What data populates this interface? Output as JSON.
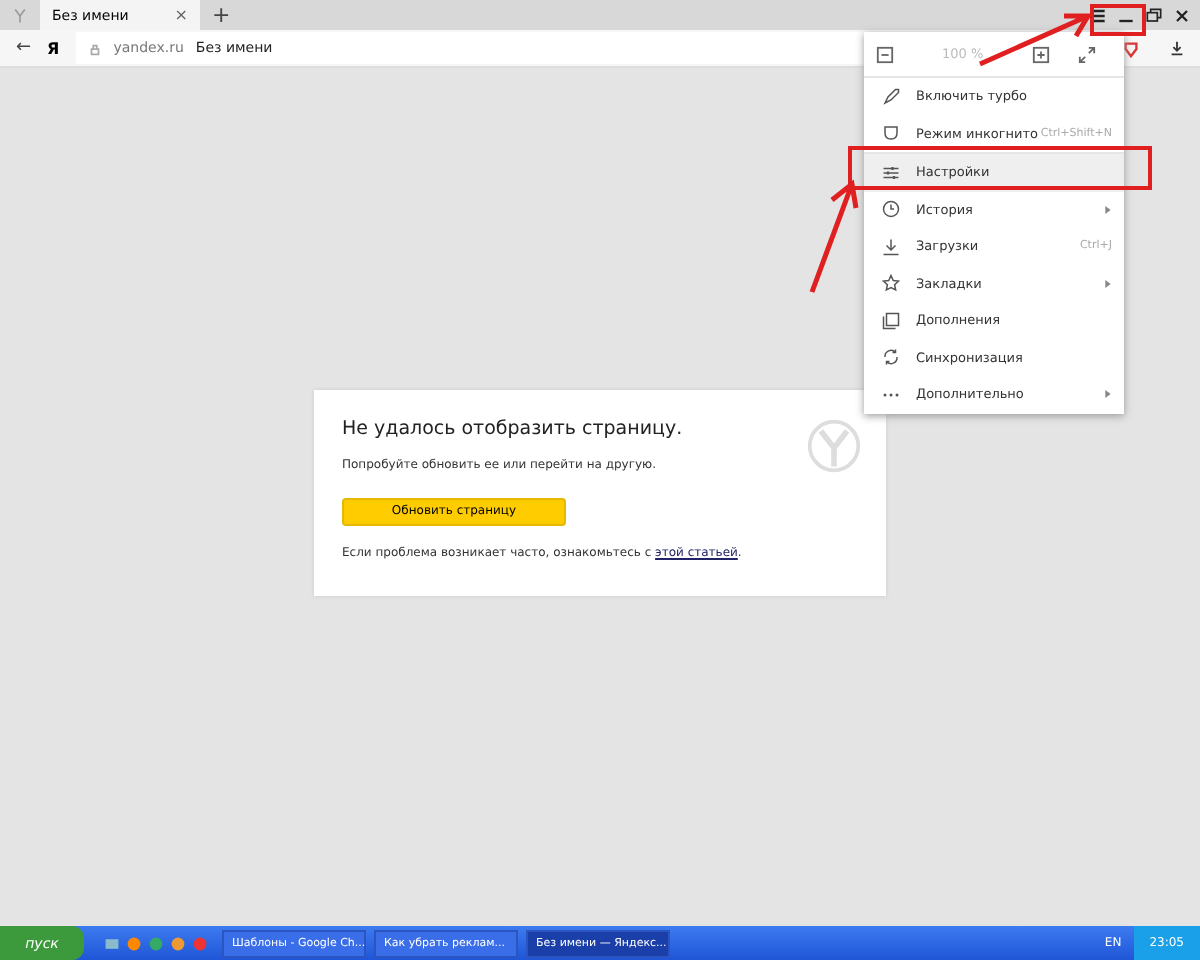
{
  "tab": {
    "title": "Без имени",
    "close": "×",
    "new_tab": "+"
  },
  "address_bar": {
    "back": "←",
    "logo": "Я",
    "domain": "yandex.ru",
    "page_title": "Без имени"
  },
  "menu": {
    "zoom": "100 %",
    "items": [
      {
        "label": "Включить турбо",
        "kind": "turbo",
        "submenu": false,
        "highlighted": false
      },
      {
        "label": "Режим инкогнито",
        "kind": "incognito",
        "shortcut": "Ctrl+Shift+N",
        "submenu": false,
        "highlighted": false
      },
      {
        "label": "Настройки",
        "kind": "settings",
        "submenu": false,
        "highlighted": true
      },
      {
        "label": "История",
        "kind": "history",
        "submenu": true,
        "highlighted": false
      },
      {
        "label": "Загрузки",
        "kind": "download",
        "shortcut": "Ctrl+J",
        "submenu": false,
        "highlighted": false
      },
      {
        "label": "Закладки",
        "kind": "star",
        "submenu": true,
        "highlighted": false
      },
      {
        "label": "Дополнения",
        "kind": "addons",
        "submenu": false,
        "highlighted": false
      },
      {
        "label": "Синхронизация",
        "kind": "sync",
        "submenu": false,
        "highlighted": false
      },
      {
        "label": "Дополнительно",
        "kind": "more",
        "submenu": true,
        "highlighted": false
      }
    ]
  },
  "error_card": {
    "title": "Не удалось отобразить страницу.",
    "hint": "Попробуйте обновить ее или перейти на другую.",
    "button": "Обновить страницу",
    "note": "Если проблема возникает часто, ознакомьтесь с ",
    "link": "этой статьей",
    "note_end": "."
  },
  "taskbar": {
    "start": "пуск",
    "windows": [
      {
        "label": "Шаблоны - Google Ch...",
        "selected": false
      },
      {
        "label": "Как убрать реклам...",
        "selected": false
      },
      {
        "label": "Без имени — Яндекс...",
        "selected": true
      }
    ],
    "lang": "EN",
    "time": "23:05"
  }
}
